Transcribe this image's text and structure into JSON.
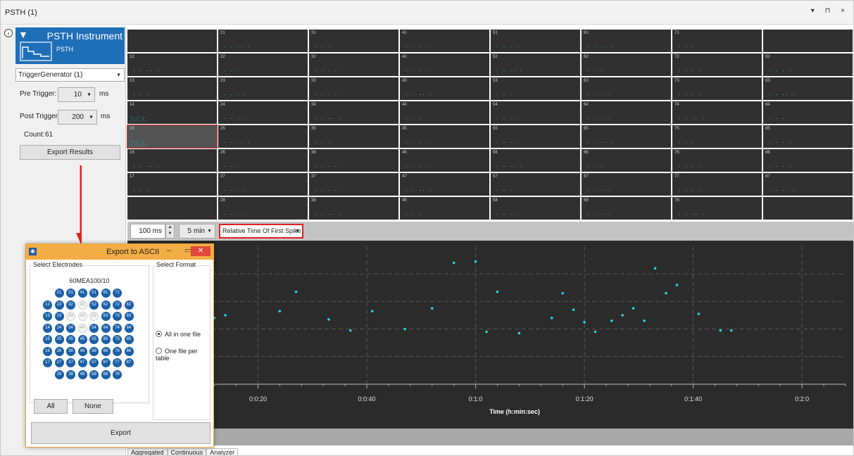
{
  "window": {
    "title": "PSTH (1)",
    "controls": "▾ ⊓ ×"
  },
  "instrument": {
    "title": "PSTH Instrument",
    "subtitle": "PSTH"
  },
  "trigger": {
    "selected": "TriggerGenerator (1)"
  },
  "pre_trigger": {
    "label": "Pre Trigger:",
    "value": "10",
    "unit": "ms"
  },
  "post_trigger": {
    "label": "Post Trigger:",
    "value": "200",
    "unit": "ms"
  },
  "count": {
    "label": "Count:",
    "value": "61"
  },
  "export_results_label": "Export Results",
  "grid": {
    "columns": [
      [
        "",
        "12",
        "13",
        "14",
        "15",
        "16",
        "17",
        ""
      ],
      [
        "21",
        "22",
        "23",
        "24",
        "25",
        "26",
        "27",
        "28"
      ],
      [
        "31",
        "32",
        "33",
        "34",
        "35",
        "36",
        "37",
        "38"
      ],
      [
        "41",
        "42",
        "43",
        "44",
        "45",
        "46",
        "47",
        "48"
      ],
      [
        "51",
        "52",
        "53",
        "54",
        "55",
        "56",
        "57",
        "58"
      ],
      [
        "61",
        "62",
        "63",
        "64",
        "65",
        "66",
        "67",
        "68"
      ],
      [
        "71",
        "72",
        "73",
        "74",
        "75",
        "76",
        "77",
        "78"
      ],
      [
        "",
        "82",
        "83",
        "84",
        "85",
        "86",
        "87",
        ""
      ]
    ],
    "selected": "15",
    "dot_color": "#2ad4e0"
  },
  "controls": {
    "bin_value": "100 ms",
    "window_value": "5 min",
    "mode_value": "Relative Time Of First Spike"
  },
  "chart_data": {
    "type": "scatter",
    "xlabel": "Time (h:min:sec)",
    "ticks": [
      "0:0:20",
      "0:0:40",
      "0:1:0",
      "0:1:20",
      "0:1:40",
      "0:2:0"
    ],
    "tick_seconds": [
      20,
      40,
      60,
      80,
      100,
      120
    ],
    "xlim": [
      -4,
      128
    ],
    "ylim": [
      0,
      1
    ],
    "grid": true,
    "points": [
      [
        -4,
        0.45
      ],
      [
        2,
        0.48
      ],
      [
        8,
        0.62
      ],
      [
        12,
        0.48
      ],
      [
        14,
        0.5
      ],
      [
        24,
        0.53
      ],
      [
        27,
        0.67
      ],
      [
        33,
        0.47
      ],
      [
        37,
        0.39
      ],
      [
        41,
        0.53
      ],
      [
        47,
        0.4
      ],
      [
        52,
        0.55
      ],
      [
        56,
        0.88
      ],
      [
        60,
        0.89
      ],
      [
        62,
        0.38
      ],
      [
        64,
        0.67
      ],
      [
        68,
        0.37
      ],
      [
        74,
        0.48
      ],
      [
        76,
        0.66
      ],
      [
        78,
        0.54
      ],
      [
        80,
        0.45
      ],
      [
        82,
        0.38
      ],
      [
        85,
        0.46
      ],
      [
        87,
        0.5
      ],
      [
        89,
        0.55
      ],
      [
        91,
        0.46
      ],
      [
        93,
        0.84
      ],
      [
        95,
        0.66
      ],
      [
        97,
        0.72
      ],
      [
        101,
        0.51
      ],
      [
        105,
        0.39
      ],
      [
        107,
        0.39
      ]
    ],
    "color": "#2ad4e0"
  },
  "tabs": [
    "Aggregated",
    "Continuous",
    "Analyzer"
  ],
  "active_tab": "Analyzer",
  "dialog": {
    "title": "Export to ASCII",
    "electrodes_label": "Select Electrodes",
    "format_label": "Select Format",
    "layout_name": "60MEA100/10",
    "electrode_rows": [
      [
        "21",
        "31",
        "41",
        "51",
        "61",
        "71"
      ],
      [
        "12",
        "22",
        "32",
        "42",
        "52",
        "62",
        "72",
        "82"
      ],
      [
        "13",
        "23",
        "33",
        "43",
        "53",
        "63",
        "73",
        "83"
      ],
      [
        "14",
        "24",
        "34",
        "44",
        "54",
        "64",
        "74",
        "84"
      ],
      [
        "15",
        "25",
        "35",
        "45",
        "55",
        "65",
        "75",
        "85"
      ],
      [
        "16",
        "26",
        "36",
        "46",
        "56",
        "66",
        "76",
        "86"
      ],
      [
        "17",
        "27",
        "37",
        "47",
        "57",
        "67",
        "77",
        "87"
      ],
      [
        "28",
        "38",
        "48",
        "58",
        "68",
        "78"
      ]
    ],
    "disabled_electrodes": [
      "42",
      "33",
      "43",
      "53",
      "44"
    ],
    "all_label": "All",
    "none_label": "None",
    "option_one": "All in one file",
    "option_two": "One file per table",
    "export_label": "Export"
  },
  "colors": {
    "accent": "#1f6fb8",
    "highlight": "#e02020",
    "dialog_title": "#f2ae44"
  }
}
